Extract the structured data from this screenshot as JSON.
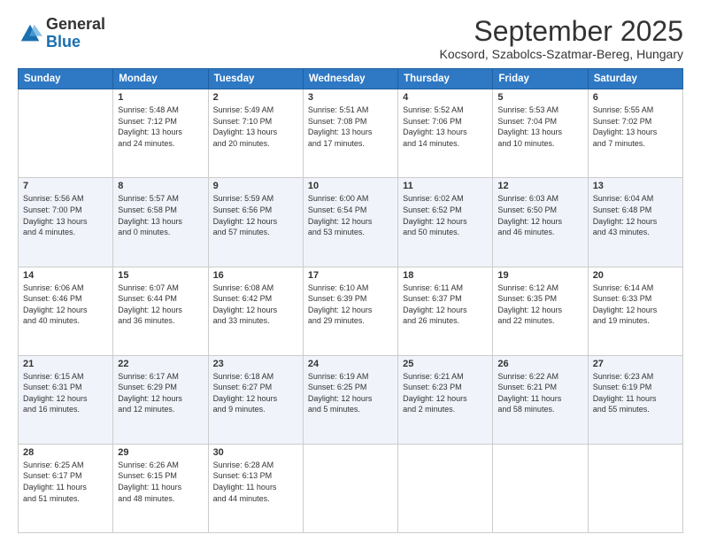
{
  "logo": {
    "line1": "General",
    "line2": "Blue"
  },
  "title": "September 2025",
  "location": "Kocsord, Szabolcs-Szatmar-Bereg, Hungary",
  "days_of_week": [
    "Sunday",
    "Monday",
    "Tuesday",
    "Wednesday",
    "Thursday",
    "Friday",
    "Saturday"
  ],
  "weeks": [
    [
      {
        "date": "",
        "info": ""
      },
      {
        "date": "1",
        "info": "Sunrise: 5:48 AM\nSunset: 7:12 PM\nDaylight: 13 hours\nand 24 minutes."
      },
      {
        "date": "2",
        "info": "Sunrise: 5:49 AM\nSunset: 7:10 PM\nDaylight: 13 hours\nand 20 minutes."
      },
      {
        "date": "3",
        "info": "Sunrise: 5:51 AM\nSunset: 7:08 PM\nDaylight: 13 hours\nand 17 minutes."
      },
      {
        "date": "4",
        "info": "Sunrise: 5:52 AM\nSunset: 7:06 PM\nDaylight: 13 hours\nand 14 minutes."
      },
      {
        "date": "5",
        "info": "Sunrise: 5:53 AM\nSunset: 7:04 PM\nDaylight: 13 hours\nand 10 minutes."
      },
      {
        "date": "6",
        "info": "Sunrise: 5:55 AM\nSunset: 7:02 PM\nDaylight: 13 hours\nand 7 minutes."
      }
    ],
    [
      {
        "date": "7",
        "info": "Sunrise: 5:56 AM\nSunset: 7:00 PM\nDaylight: 13 hours\nand 4 minutes."
      },
      {
        "date": "8",
        "info": "Sunrise: 5:57 AM\nSunset: 6:58 PM\nDaylight: 13 hours\nand 0 minutes."
      },
      {
        "date": "9",
        "info": "Sunrise: 5:59 AM\nSunset: 6:56 PM\nDaylight: 12 hours\nand 57 minutes."
      },
      {
        "date": "10",
        "info": "Sunrise: 6:00 AM\nSunset: 6:54 PM\nDaylight: 12 hours\nand 53 minutes."
      },
      {
        "date": "11",
        "info": "Sunrise: 6:02 AM\nSunset: 6:52 PM\nDaylight: 12 hours\nand 50 minutes."
      },
      {
        "date": "12",
        "info": "Sunrise: 6:03 AM\nSunset: 6:50 PM\nDaylight: 12 hours\nand 46 minutes."
      },
      {
        "date": "13",
        "info": "Sunrise: 6:04 AM\nSunset: 6:48 PM\nDaylight: 12 hours\nand 43 minutes."
      }
    ],
    [
      {
        "date": "14",
        "info": "Sunrise: 6:06 AM\nSunset: 6:46 PM\nDaylight: 12 hours\nand 40 minutes."
      },
      {
        "date": "15",
        "info": "Sunrise: 6:07 AM\nSunset: 6:44 PM\nDaylight: 12 hours\nand 36 minutes."
      },
      {
        "date": "16",
        "info": "Sunrise: 6:08 AM\nSunset: 6:42 PM\nDaylight: 12 hours\nand 33 minutes."
      },
      {
        "date": "17",
        "info": "Sunrise: 6:10 AM\nSunset: 6:39 PM\nDaylight: 12 hours\nand 29 minutes."
      },
      {
        "date": "18",
        "info": "Sunrise: 6:11 AM\nSunset: 6:37 PM\nDaylight: 12 hours\nand 26 minutes."
      },
      {
        "date": "19",
        "info": "Sunrise: 6:12 AM\nSunset: 6:35 PM\nDaylight: 12 hours\nand 22 minutes."
      },
      {
        "date": "20",
        "info": "Sunrise: 6:14 AM\nSunset: 6:33 PM\nDaylight: 12 hours\nand 19 minutes."
      }
    ],
    [
      {
        "date": "21",
        "info": "Sunrise: 6:15 AM\nSunset: 6:31 PM\nDaylight: 12 hours\nand 16 minutes."
      },
      {
        "date": "22",
        "info": "Sunrise: 6:17 AM\nSunset: 6:29 PM\nDaylight: 12 hours\nand 12 minutes."
      },
      {
        "date": "23",
        "info": "Sunrise: 6:18 AM\nSunset: 6:27 PM\nDaylight: 12 hours\nand 9 minutes."
      },
      {
        "date": "24",
        "info": "Sunrise: 6:19 AM\nSunset: 6:25 PM\nDaylight: 12 hours\nand 5 minutes."
      },
      {
        "date": "25",
        "info": "Sunrise: 6:21 AM\nSunset: 6:23 PM\nDaylight: 12 hours\nand 2 minutes."
      },
      {
        "date": "26",
        "info": "Sunrise: 6:22 AM\nSunset: 6:21 PM\nDaylight: 11 hours\nand 58 minutes."
      },
      {
        "date": "27",
        "info": "Sunrise: 6:23 AM\nSunset: 6:19 PM\nDaylight: 11 hours\nand 55 minutes."
      }
    ],
    [
      {
        "date": "28",
        "info": "Sunrise: 6:25 AM\nSunset: 6:17 PM\nDaylight: 11 hours\nand 51 minutes."
      },
      {
        "date": "29",
        "info": "Sunrise: 6:26 AM\nSunset: 6:15 PM\nDaylight: 11 hours\nand 48 minutes."
      },
      {
        "date": "30",
        "info": "Sunrise: 6:28 AM\nSunset: 6:13 PM\nDaylight: 11 hours\nand 44 minutes."
      },
      {
        "date": "",
        "info": ""
      },
      {
        "date": "",
        "info": ""
      },
      {
        "date": "",
        "info": ""
      },
      {
        "date": "",
        "info": ""
      }
    ]
  ]
}
